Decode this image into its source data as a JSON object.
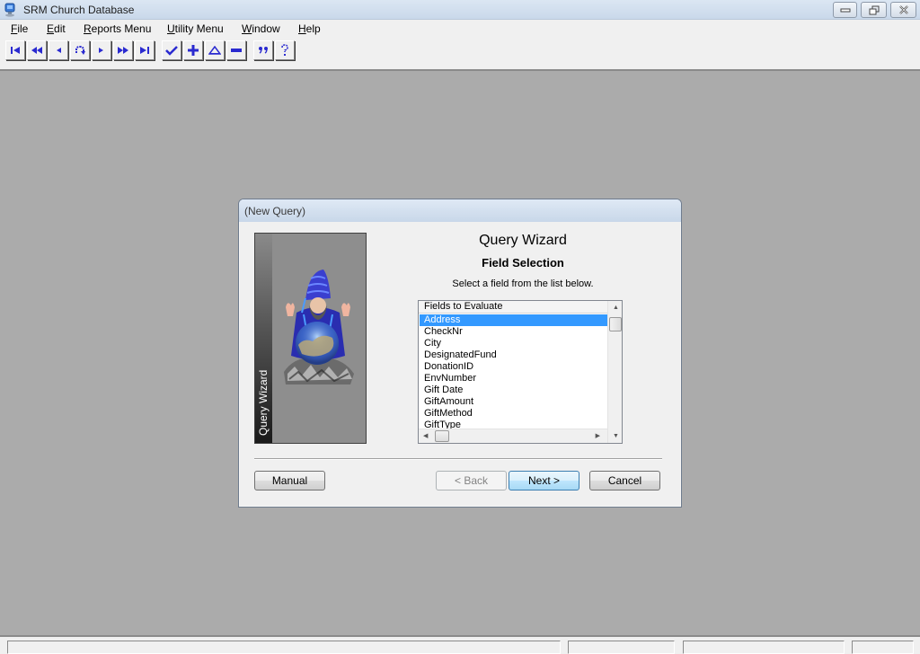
{
  "window": {
    "title": "SRM Church Database",
    "controls": {
      "minimize": "minimize-icon",
      "restore": "restore-icon",
      "close": "close-icon"
    }
  },
  "menubar": {
    "items": [
      {
        "accel": "F",
        "rest": "ile",
        "label": "File"
      },
      {
        "accel": "E",
        "rest": "dit",
        "label": "Edit"
      },
      {
        "accel": "R",
        "rest": "eports Menu",
        "label": "Reports Menu"
      },
      {
        "accel": "U",
        "rest": "tility Menu",
        "label": "Utility Menu"
      },
      {
        "accel": "W",
        "rest": "indow",
        "label": "Window"
      },
      {
        "accel": "H",
        "rest": "elp",
        "label": "Help"
      }
    ]
  },
  "toolbar": {
    "buttons": [
      {
        "name": "first-record",
        "icon": "first-record-icon"
      },
      {
        "name": "previous-page",
        "icon": "rewind-icon"
      },
      {
        "name": "previous-record",
        "icon": "previous-icon"
      },
      {
        "name": "undo",
        "icon": "undo-icon"
      },
      {
        "name": "next-record",
        "icon": "next-icon"
      },
      {
        "name": "next-page",
        "icon": "fast-forward-icon"
      },
      {
        "name": "last-record",
        "icon": "last-record-icon"
      },
      {
        "name": "save",
        "icon": "checkmark-icon"
      },
      {
        "name": "add",
        "icon": "plus-icon"
      },
      {
        "name": "edit",
        "icon": "triangle-up-icon"
      },
      {
        "name": "delete",
        "icon": "minus-icon"
      },
      {
        "name": "quote",
        "icon": "quote-icon"
      },
      {
        "name": "help",
        "icon": "question-icon"
      }
    ]
  },
  "dialog": {
    "title": "(New Query)",
    "side_label": "Query Wizard",
    "heading": "Query Wizard",
    "subheading": "Field Selection",
    "instruction": "Select a field from the list below.",
    "list": {
      "header": "Fields to Evaluate",
      "selected_index": 0,
      "items": [
        "Address",
        "CheckNr",
        "City",
        "DesignatedFund",
        "DonationID",
        "EnvNumber",
        "Gift Date",
        "GiftAmount",
        "GiftMethod",
        "GiftType"
      ]
    },
    "buttons": {
      "manual": "Manual",
      "back": "< Back",
      "next": "Next >",
      "cancel": "Cancel"
    }
  },
  "statusbar": {
    "panels": [
      "",
      "",
      "",
      ""
    ]
  }
}
